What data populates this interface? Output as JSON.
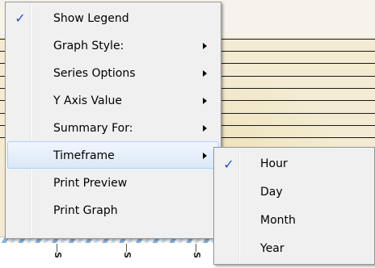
{
  "main_menu": {
    "items": [
      {
        "label": "Show Legend",
        "checked": true,
        "has_submenu": false
      },
      {
        "label": "Graph Style:",
        "checked": false,
        "has_submenu": true
      },
      {
        "label": "Series Options",
        "checked": false,
        "has_submenu": true
      },
      {
        "label": "Y Axis Value",
        "checked": false,
        "has_submenu": true
      },
      {
        "label": "Summary For:",
        "checked": false,
        "has_submenu": true
      },
      {
        "label": "Timeframe",
        "checked": false,
        "has_submenu": true,
        "highlighted": true
      },
      {
        "label": "Print Preview",
        "checked": false,
        "has_submenu": false
      },
      {
        "label": "Print Graph",
        "checked": false,
        "has_submenu": false
      }
    ]
  },
  "timeframe_submenu": {
    "items": [
      {
        "label": "Hour",
        "checked": true
      },
      {
        "label": "Day",
        "checked": false
      },
      {
        "label": "Month",
        "checked": false
      },
      {
        "label": "Year",
        "checked": false
      }
    ]
  },
  "graph": {
    "axis_labels": [
      "S",
      "S",
      "S"
    ]
  },
  "icons": {
    "check": "checkmark-icon",
    "submenu_arrow": "submenu-arrow-icon"
  },
  "colors": {
    "menu_bg": "#f0f0f0",
    "highlight_border": "#aecff7",
    "check_color": "#1a55c4",
    "graph_bg": "#f3ebd2"
  }
}
